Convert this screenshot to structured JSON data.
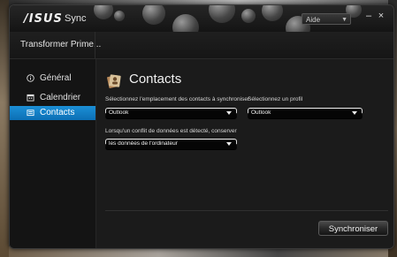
{
  "app": {
    "logo": "/ISUS",
    "name": "Sync",
    "help_label": "Aide",
    "minimize_symbol": "–",
    "close_symbol": "×"
  },
  "device": {
    "name": "Transformer Prime..."
  },
  "sidebar": {
    "items": [
      {
        "label": "Général",
        "icon": "info-icon",
        "active": false
      },
      {
        "label": "Calendrier",
        "icon": "calendar-icon",
        "active": false
      },
      {
        "label": "Contacts",
        "icon": "contacts-icon",
        "active": true
      }
    ]
  },
  "main": {
    "title": "Contacts",
    "icon": "contacts-card-icon",
    "sync_location_label": "Sélectionnez l'emplacement des contacts à synchroniser",
    "sync_location_value": "Outlook",
    "profile_label": "Sélectionnez un profil",
    "profile_value": "Outlook",
    "conflict_label": "Lorsqu'un conflit de données est détecté, conserver",
    "conflict_value": "les données de l'ordinateur",
    "sync_button": "Synchroniser"
  },
  "colors": {
    "accent": "#0b6fb5",
    "window_bg": "#131313",
    "panel_bg": "#1b1b1b"
  }
}
